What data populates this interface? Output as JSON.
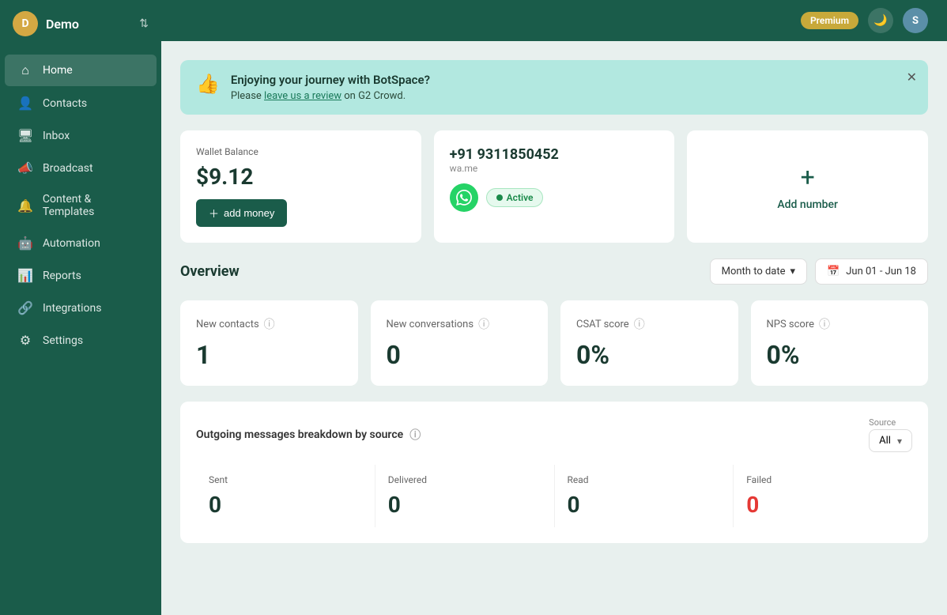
{
  "sidebar": {
    "workspace": "Demo",
    "avatar_letter": "D",
    "items": [
      {
        "id": "home",
        "label": "Home",
        "icon": "⌂",
        "active": true
      },
      {
        "id": "contacts",
        "label": "Contacts",
        "icon": "👤"
      },
      {
        "id": "inbox",
        "label": "Inbox",
        "icon": "🖥"
      },
      {
        "id": "broadcast",
        "label": "Broadcast",
        "icon": "📣"
      },
      {
        "id": "content",
        "label": "Content & Templates",
        "icon": "🔔"
      },
      {
        "id": "automation",
        "label": "Automation",
        "icon": "🤖"
      },
      {
        "id": "reports",
        "label": "Reports",
        "icon": "📊"
      },
      {
        "id": "integrations",
        "label": "Integrations",
        "icon": "🔗"
      },
      {
        "id": "settings",
        "label": "Settings",
        "icon": "⚙"
      }
    ]
  },
  "topbar": {
    "premium_label": "Premium",
    "user_letter": "S"
  },
  "banner": {
    "icon": "👍",
    "title": "Enjoying your journey with BotSpace?",
    "desc_prefix": "Please ",
    "link_text": "leave us a review",
    "desc_suffix": " on G2 Crowd."
  },
  "wallet": {
    "label": "Wallet Balance",
    "value": "$9.12",
    "add_money_label": "add money"
  },
  "phone_card": {
    "phone": "+91 9311850452",
    "sub": "wa.me",
    "active_label": "Active"
  },
  "add_number": {
    "icon": "+",
    "label": "Add number"
  },
  "overview": {
    "title": "Overview",
    "date_filter": "Month to date",
    "date_range": "Jun 01 - Jun 18",
    "metrics": [
      {
        "id": "new-contacts",
        "label": "New contacts",
        "value": "1"
      },
      {
        "id": "new-conversations",
        "label": "New conversations",
        "value": "0"
      },
      {
        "id": "csat-score",
        "label": "CSAT score",
        "value": "0%"
      },
      {
        "id": "nps-score",
        "label": "NPS score",
        "value": "0%"
      }
    ]
  },
  "breakdown": {
    "title": "Outgoing messages breakdown by source",
    "source_label": "Source",
    "source_value": "All",
    "stats": [
      {
        "id": "sent",
        "label": "Sent",
        "value": "0",
        "red": false
      },
      {
        "id": "delivered",
        "label": "Delivered",
        "value": "0",
        "red": false
      },
      {
        "id": "read",
        "label": "Read",
        "value": "0",
        "red": false
      },
      {
        "id": "failed",
        "label": "Failed",
        "value": "0",
        "red": true
      }
    ]
  }
}
